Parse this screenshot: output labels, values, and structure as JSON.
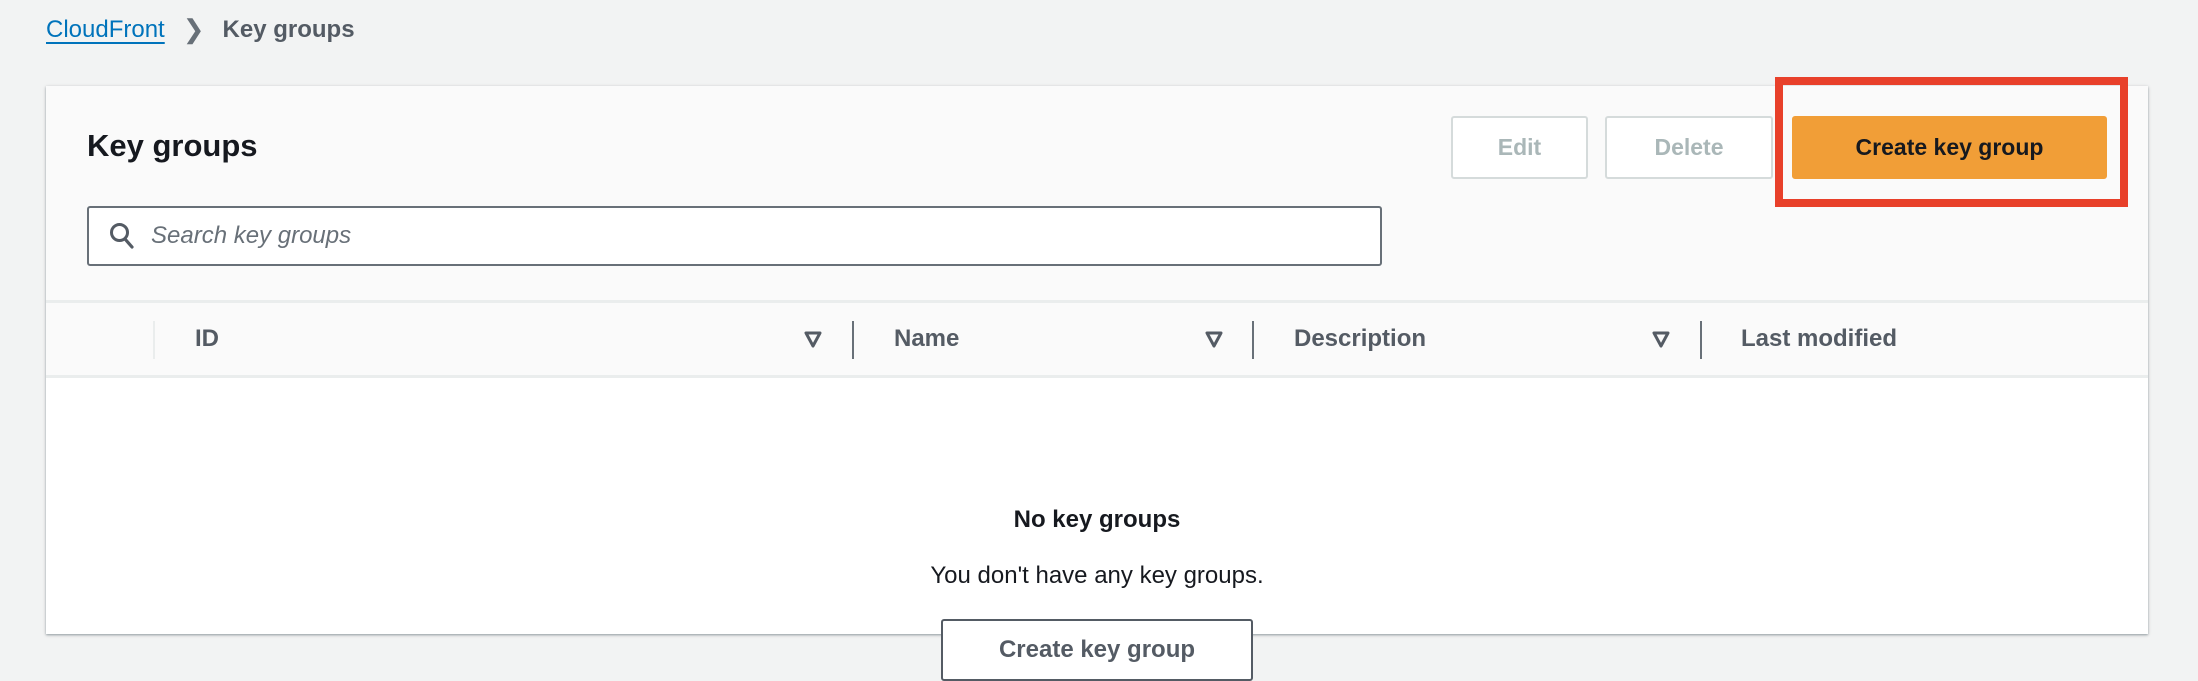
{
  "breadcrumb": {
    "root": "CloudFront",
    "current": "Key groups"
  },
  "panel": {
    "title": "Key groups",
    "buttons": {
      "edit": "Edit",
      "delete": "Delete",
      "create": "Create key group"
    },
    "search": {
      "placeholder": "Search key groups",
      "value": ""
    },
    "columns": [
      "ID",
      "Name",
      "Description",
      "Last modified"
    ],
    "empty": {
      "title": "No key groups",
      "text": "You don't have any key groups.",
      "button": "Create key group"
    }
  },
  "colors": {
    "primary": "#f19e37",
    "highlight": "#e8402a",
    "link": "#0073bb"
  }
}
